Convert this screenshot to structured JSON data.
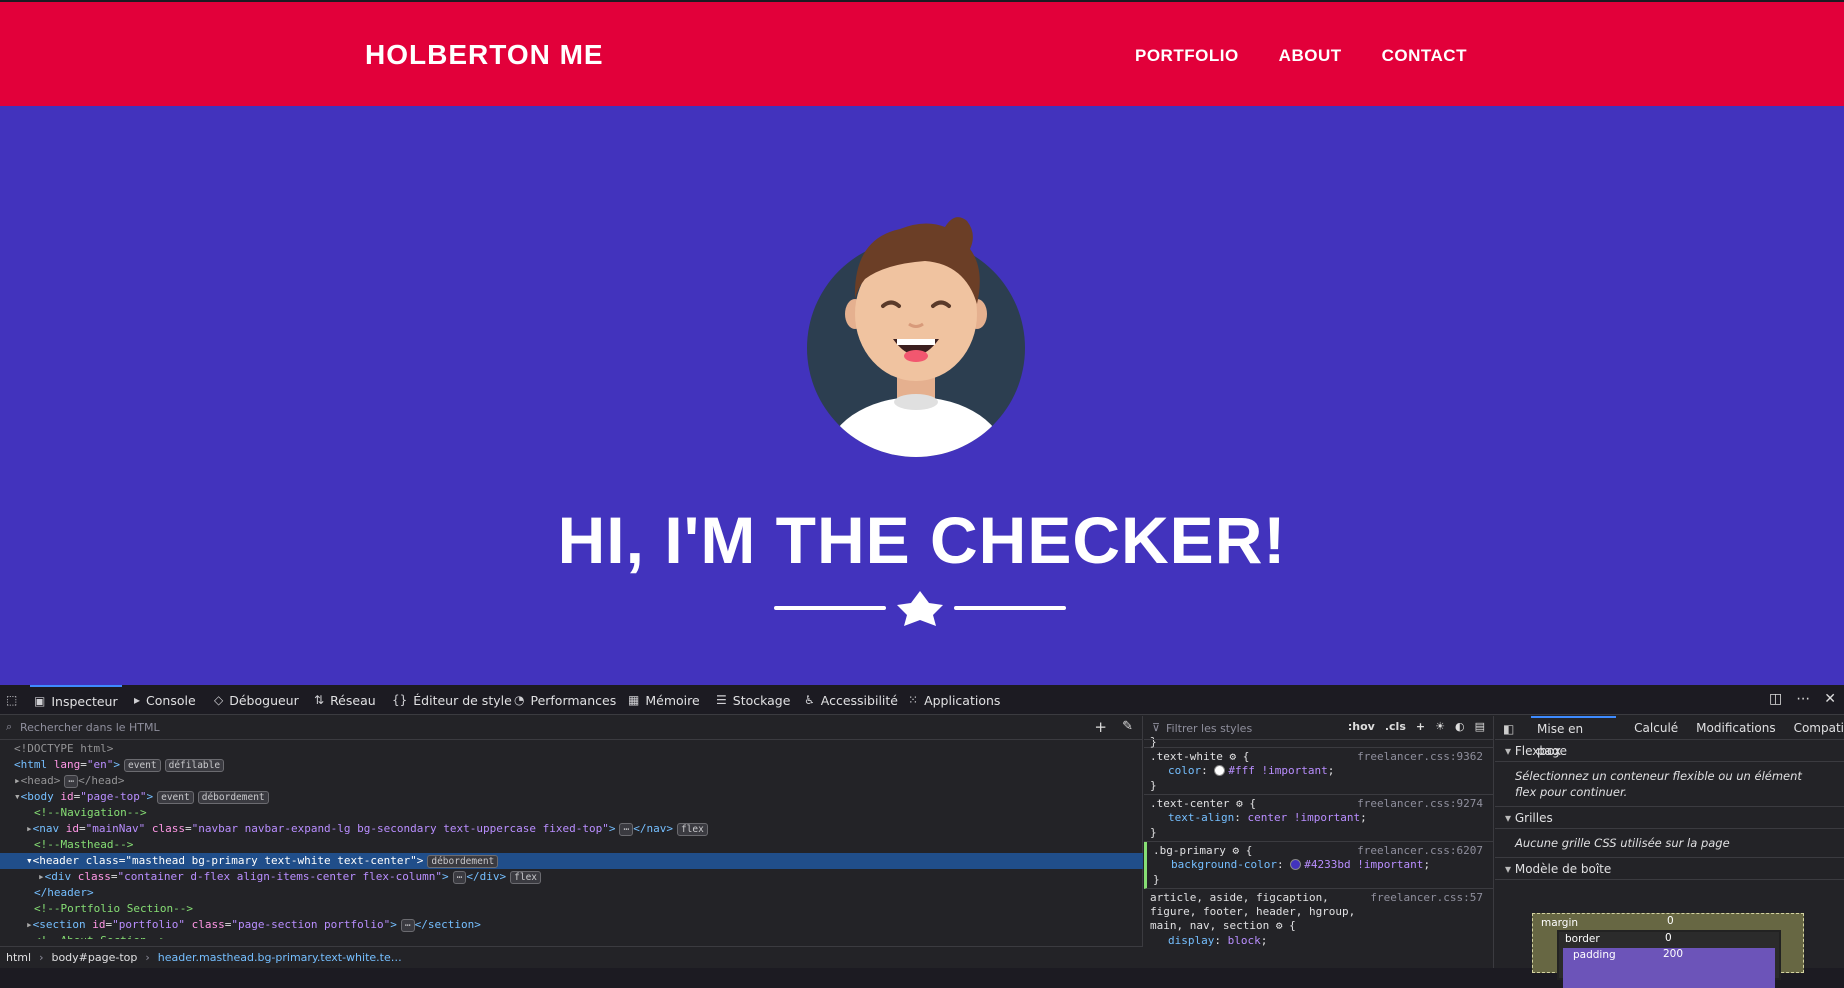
{
  "site": {
    "brand": "HOLBERTON ME",
    "nav": [
      "PORTFOLIO",
      "ABOUT",
      "CONTACT"
    ],
    "headline": "HI, I'M THE CHECKER!",
    "colors": {
      "nav_bg": "#e2003a",
      "hero_bg": "#4233bd",
      "text": "#ffffff"
    }
  },
  "devtools": {
    "tabs": [
      {
        "label": "Inspecteur",
        "icon": "inspector-icon"
      },
      {
        "label": "Console",
        "icon": "console-icon"
      },
      {
        "label": "Débogueur",
        "icon": "debugger-icon"
      },
      {
        "label": "Réseau",
        "icon": "network-icon"
      },
      {
        "label": "Éditeur de style",
        "icon": "style-editor-icon"
      },
      {
        "label": "Performances",
        "icon": "performance-icon"
      },
      {
        "label": "Mémoire",
        "icon": "memory-icon"
      },
      {
        "label": "Stockage",
        "icon": "storage-icon"
      },
      {
        "label": "Accessibilité",
        "icon": "accessibility-icon"
      },
      {
        "label": "Applications",
        "icon": "applications-icon"
      }
    ],
    "search_placeholder": "Rechercher dans le HTML",
    "breadcrumbs": [
      "html",
      "body#page-top",
      "header.masthead.bg-primary.text-white.te…"
    ],
    "styles_filter_placeholder": "Filtrer les styles",
    "styles_tools": [
      ":hov",
      ".cls"
    ],
    "rules": [
      {
        "selector": ".text-white",
        "source": "freelancer.css:9362",
        "props": [
          {
            "name": "color",
            "value": "#fff !important",
            "swatch": "#ffffff"
          }
        ]
      },
      {
        "selector": ".text-center",
        "source": "freelancer.css:9274",
        "props": [
          {
            "name": "text-align",
            "value": "center !important"
          }
        ]
      },
      {
        "selector": ".bg-primary",
        "source": "freelancer.css:6207",
        "props": [
          {
            "name": "background-color",
            "value": "#4233bd !important",
            "swatch": "#4233bd"
          }
        ]
      },
      {
        "selector": "article, aside, figcaption, figure, footer, header, hgroup, main, nav, section",
        "source": "freelancer.css:57",
        "props": [
          {
            "name": "display",
            "value": "block"
          }
        ]
      }
    ],
    "layout_tabs": [
      "Mise en page",
      "Calculé",
      "Modifications",
      "Compati"
    ],
    "flexbox_title": "Flexbox",
    "flexbox_note": "Sélectionnez un conteneur flexible ou un élément flex pour continuer.",
    "grid_title": "Grilles",
    "grid_note": "Aucune grille CSS utilisée sur la page",
    "boxmodel_title": "Modèle de boîte",
    "boxmodel": {
      "margin_label": "margin",
      "margin": "0",
      "border_label": "border",
      "border": "0",
      "padding_label": "padding",
      "padding": "200"
    }
  }
}
